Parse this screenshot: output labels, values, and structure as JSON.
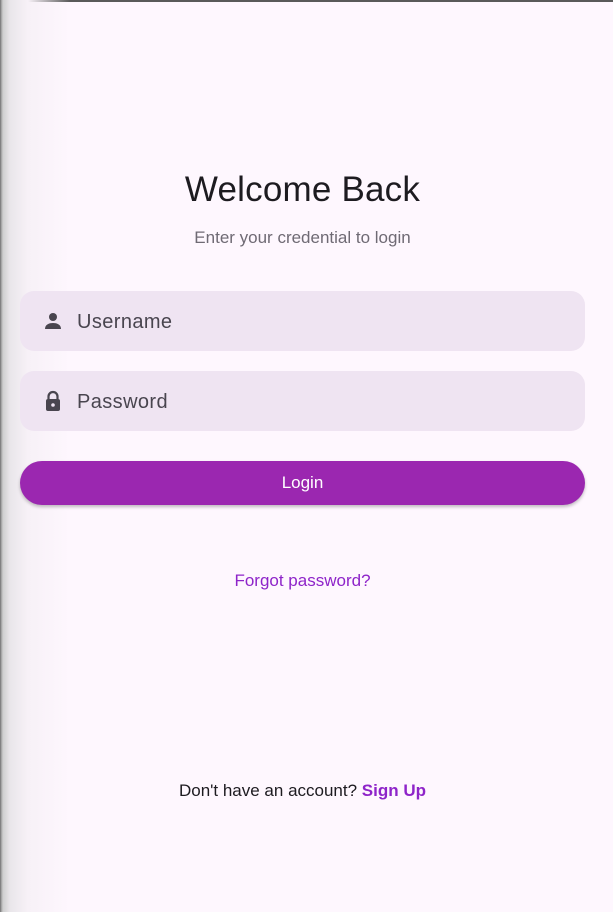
{
  "header": {
    "title": "Welcome Back",
    "subtitle": "Enter your credential to login"
  },
  "form": {
    "username": {
      "placeholder": "Username",
      "value": "",
      "icon": "person-icon"
    },
    "password": {
      "placeholder": "Password",
      "value": "",
      "icon": "lock-icon"
    },
    "login_label": "Login"
  },
  "links": {
    "forgot_password": "Forgot password?",
    "signup_prompt": "Don't have an account?",
    "signup_label": "Sign Up"
  },
  "colors": {
    "background": "#fef7fe",
    "field_fill": "#efe4f2",
    "primary": "#9b27b0",
    "link": "#8e24c9",
    "text": "#1d1b20"
  }
}
